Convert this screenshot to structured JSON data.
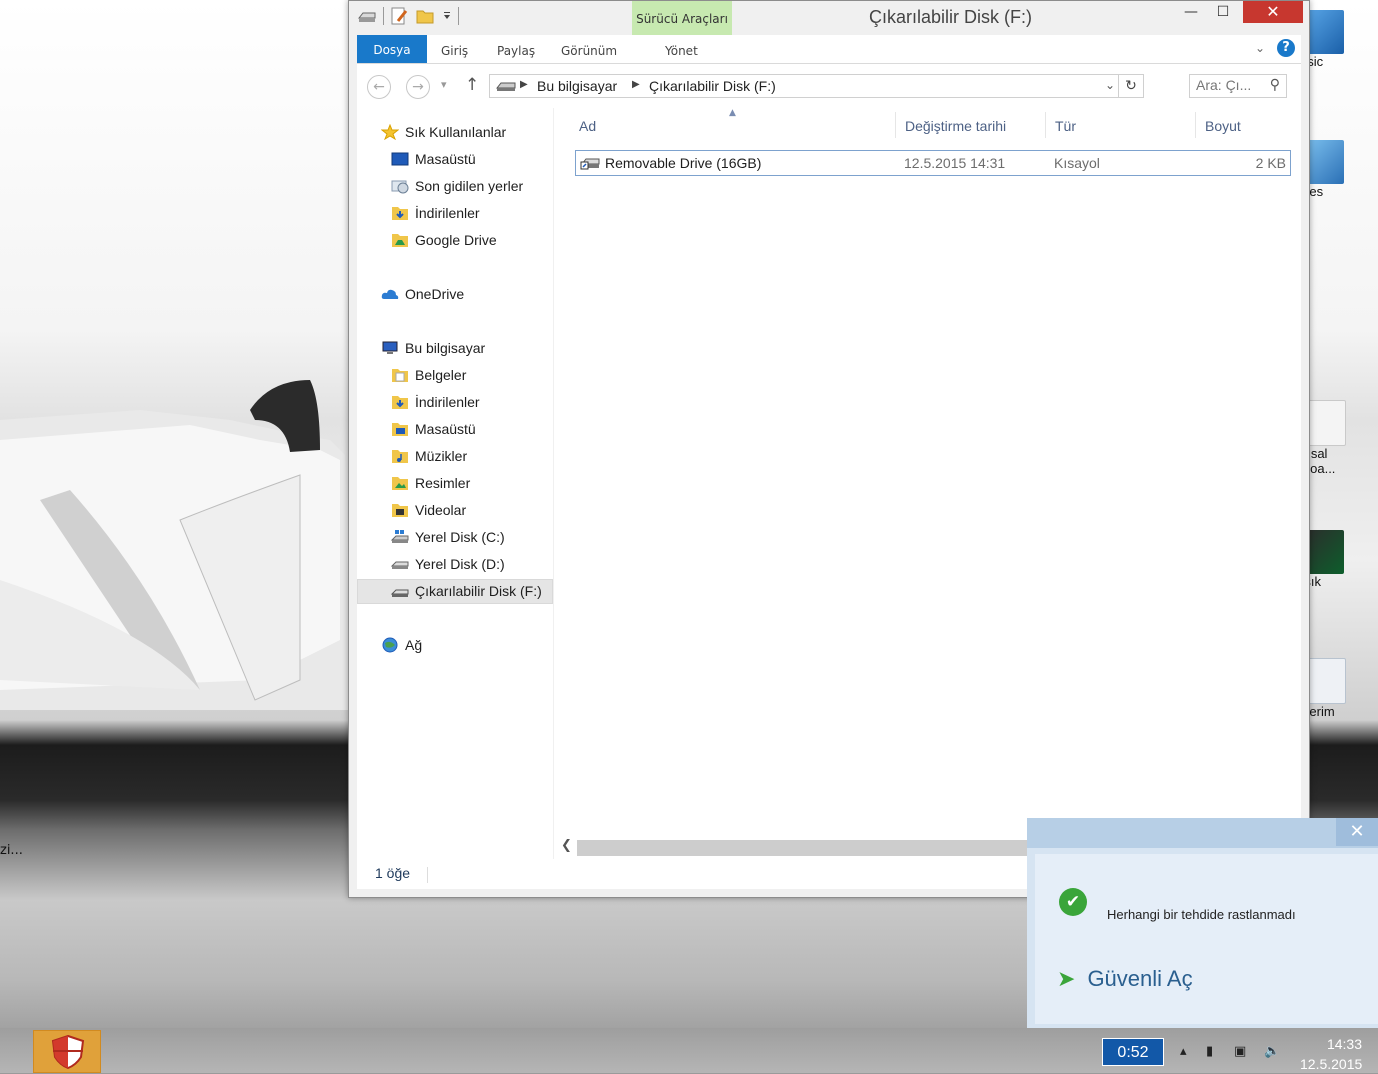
{
  "window": {
    "title": "Çıkarılabilir Disk (F:)",
    "contextual_tab": "Sürücü Araçları",
    "buttons": {
      "minimize": "—",
      "maximize": "☐",
      "close": "✕"
    }
  },
  "ribbon": {
    "tabs": [
      {
        "label": "Dosya"
      },
      {
        "label": "Giriş"
      },
      {
        "label": "Paylaş"
      },
      {
        "label": "Görünüm"
      },
      {
        "label": "Yönet"
      }
    ],
    "help": "?"
  },
  "address_bar": {
    "crumbs": [
      "Bu bilgisayar",
      "Çıkarılabilir Disk (F:)"
    ]
  },
  "search": {
    "placeholder": "Ara: Çı..."
  },
  "navigation": {
    "items": [
      {
        "label": "Sık Kullanılanlar",
        "icon": "star-icon"
      },
      {
        "label": "Masaüstü",
        "icon": "desktop-icon"
      },
      {
        "label": "Son gidilen yerler",
        "icon": "recent-places-icon"
      },
      {
        "label": "İndirilenler",
        "icon": "downloads-folder-icon"
      },
      {
        "label": "Google Drive",
        "icon": "google-drive-folder-icon"
      },
      {
        "label": "OneDrive",
        "icon": "onedrive-cloud-icon"
      },
      {
        "label": "Bu bilgisayar",
        "icon": "computer-icon"
      },
      {
        "label": "Belgeler",
        "icon": "documents-folder-icon"
      },
      {
        "label": "İndirilenler",
        "icon": "downloads-folder-icon"
      },
      {
        "label": "Masaüstü",
        "icon": "desktop-folder-icon"
      },
      {
        "label": "Müzikler",
        "icon": "music-folder-icon"
      },
      {
        "label": "Resimler",
        "icon": "pictures-folder-icon"
      },
      {
        "label": "Videolar",
        "icon": "videos-folder-icon"
      },
      {
        "label": "Yerel Disk (C:)",
        "icon": "windows-drive-icon"
      },
      {
        "label": "Yerel Disk (D:)",
        "icon": "drive-icon"
      },
      {
        "label": "Çıkarılabilir Disk (F:)",
        "icon": "removable-drive-icon"
      },
      {
        "label": "Ağ",
        "icon": "network-icon"
      }
    ]
  },
  "file_list": {
    "columns": [
      "Ad",
      "Değiştirme tarihi",
      "Tür",
      "Boyut"
    ],
    "rows": [
      {
        "name": "Removable Drive (16GB)",
        "modified": "12.5.2015 14:31",
        "type": "Kısayol",
        "size": "2 KB"
      }
    ]
  },
  "status_bar": {
    "count": "1 öğe"
  },
  "desktop": {
    "icons": [
      "usic",
      "vies",
      "msal\nnloa...",
      "rşık",
      "slerim"
    ],
    "left_label": "zi..."
  },
  "antivirus_popup": {
    "message": "Herhangi bir tehdide rastlanmadı",
    "safe_open": "Güvenli Aç",
    "close": "✕"
  },
  "taskbar": {
    "battery": "0:52",
    "time": "14:33",
    "date": "12.5.2015"
  },
  "colors": {
    "accent": "#1979ca",
    "contextual": "#c7e9b0",
    "close": "#c7372f"
  }
}
